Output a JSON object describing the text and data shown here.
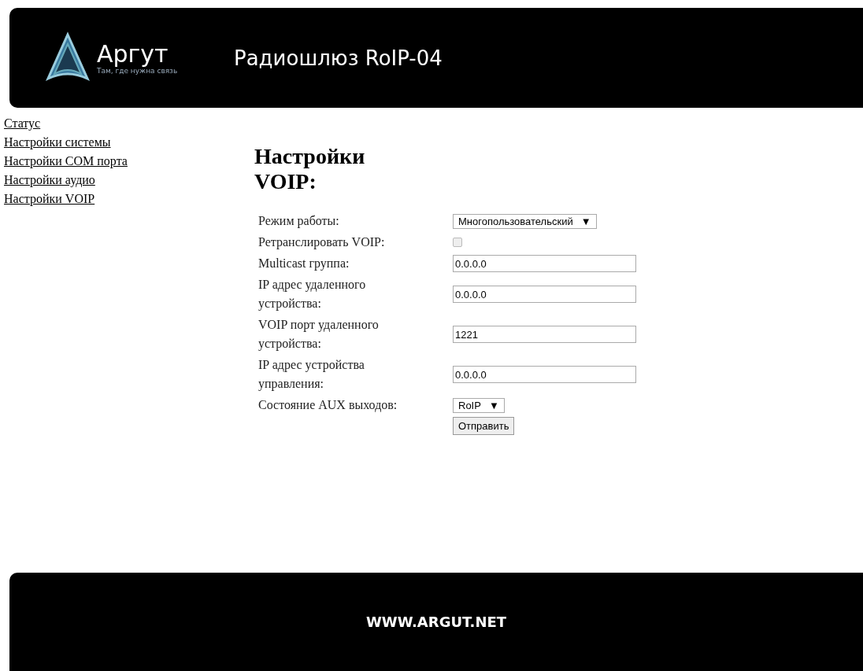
{
  "header": {
    "logo": {
      "name": "Аргут",
      "tagline": "Там, где нужна связь"
    },
    "title": "Радиошлюз RoIP-04"
  },
  "sidebar": {
    "items": [
      {
        "label": "Статус"
      },
      {
        "label": "Настройки системы"
      },
      {
        "label": "Настройки COM порта"
      },
      {
        "label": "Настройки аудио"
      },
      {
        "label": "Настройки VOIP"
      }
    ]
  },
  "form": {
    "heading": "Настройки VOIP:",
    "rows": [
      {
        "kind": "select",
        "label": "Режим работы:",
        "value": "Многопользовательский",
        "arrow": "▼"
      },
      {
        "kind": "checkbox",
        "label": "Ретранслировать VOIP:",
        "checked": false
      },
      {
        "kind": "input",
        "label": "Multicast группа:",
        "value": "0.0.0.0"
      },
      {
        "kind": "input",
        "label": "IP адрес удаленного устройства:",
        "value": "0.0.0.0"
      },
      {
        "kind": "input",
        "label": "VOIP порт удаленного устройства:",
        "value": "1221"
      },
      {
        "kind": "input",
        "label": "IP адрес устройства управления:",
        "value": "0.0.0.0"
      },
      {
        "kind": "select",
        "label": "Состояние AUX выходов:",
        "value": "RoIP",
        "arrow": "▼"
      }
    ],
    "submit": "Отправить"
  },
  "footer": {
    "text": "WWW.ARGUT.NET"
  }
}
